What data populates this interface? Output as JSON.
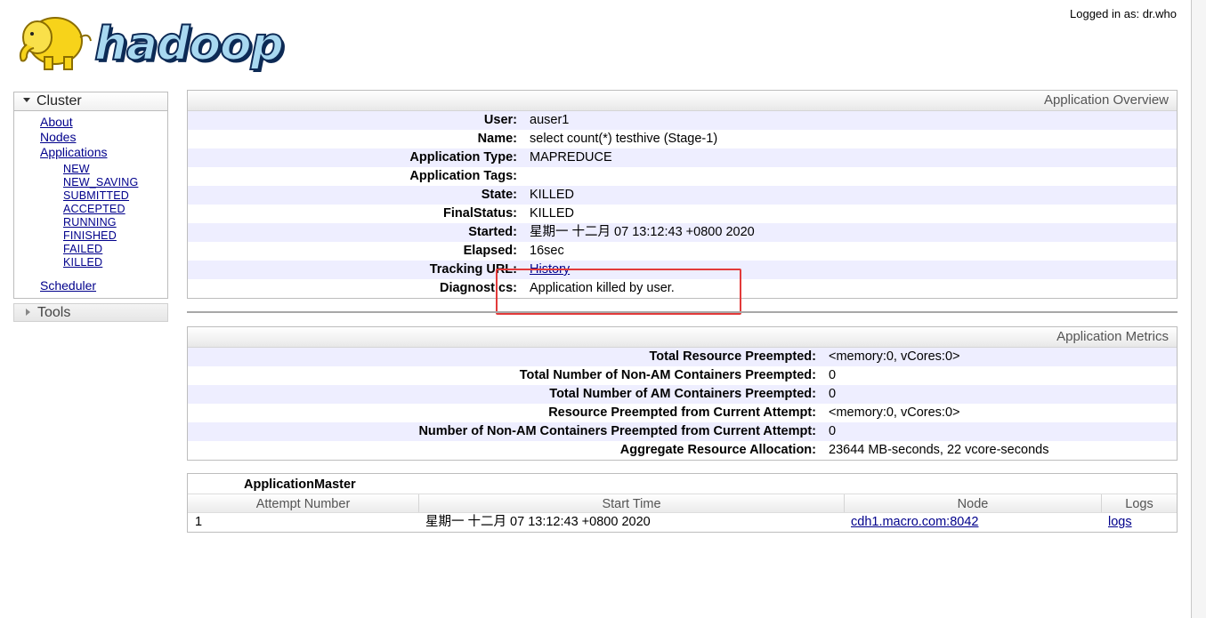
{
  "header": {
    "logo_text": "hadoop",
    "logged_in": "Logged in as: dr.who"
  },
  "sidebar": {
    "cluster_label": "Cluster",
    "cluster_links": [
      "About",
      "Nodes",
      "Applications"
    ],
    "app_states": [
      "NEW",
      "NEW_SAVING",
      "SUBMITTED",
      "ACCEPTED",
      "RUNNING",
      "FINISHED",
      "FAILED",
      "KILLED"
    ],
    "scheduler_label": "Scheduler",
    "tools_label": "Tools"
  },
  "overview": {
    "title": "Application Overview",
    "rows": [
      {
        "key": "User:",
        "value": "auser1"
      },
      {
        "key": "Name:",
        "value": "select count(*) testhive (Stage-1)"
      },
      {
        "key": "Application Type:",
        "value": "MAPREDUCE"
      },
      {
        "key": "Application Tags:",
        "value": ""
      },
      {
        "key": "State:",
        "value": "KILLED"
      },
      {
        "key": "FinalStatus:",
        "value": "KILLED"
      },
      {
        "key": "Started:",
        "value": "星期一 十二月 07 13:12:43 +0800 2020"
      },
      {
        "key": "Elapsed:",
        "value": "16sec"
      },
      {
        "key": "Tracking URL:",
        "value": "History"
      },
      {
        "key": "Diagnostics:",
        "value": "Application killed by user."
      }
    ]
  },
  "metrics": {
    "title": "Application Metrics",
    "rows": [
      {
        "key": "Total Resource Preempted:",
        "value": "<memory:0, vCores:0>"
      },
      {
        "key": "Total Number of Non-AM Containers Preempted:",
        "value": "0"
      },
      {
        "key": "Total Number of AM Containers Preempted:",
        "value": "0"
      },
      {
        "key": "Resource Preempted from Current Attempt:",
        "value": "<memory:0, vCores:0>"
      },
      {
        "key": "Number of Non-AM Containers Preempted from Current Attempt:",
        "value": "0"
      },
      {
        "key": "Aggregate Resource Allocation:",
        "value": "23644 MB-seconds, 22 vcore-seconds"
      }
    ]
  },
  "attempts": {
    "title": "ApplicationMaster",
    "columns": [
      "Attempt Number",
      "Start Time",
      "Node",
      "Logs"
    ],
    "rows": [
      {
        "attempt": "1",
        "start": "星期一 十二月 07 13:12:43 +0800 2020",
        "node": "cdh1.macro.com:8042",
        "logs": "logs"
      }
    ]
  },
  "colors": {
    "link": "#00008b",
    "row_stripe": "#eeeeff",
    "highlight": "#e23a3a"
  }
}
